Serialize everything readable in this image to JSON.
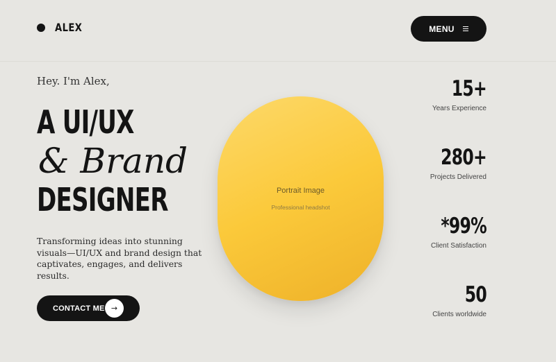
{
  "header": {
    "logo_text": "ALEX",
    "menu_label": "MENU",
    "menu_icon": "hamburger-icon"
  },
  "hero": {
    "greeting": "Hey. I'm Alex,",
    "headline_line1": "A UI/UX",
    "headline_line2": "& Brand",
    "headline_line3": "DESIGNER",
    "intro": "Transforming ideas into stunning visuals—UI/UX and brand design that captivates, engages, and delivers results.",
    "contact_label": "CONTACT ME",
    "contact_icon": "arrow-right-icon",
    "contact_arrow_glyph": "→"
  },
  "portrait": {
    "title": "Portrait Image",
    "subtitle": "Professional headshot",
    "colors": [
      "#fdd96a",
      "#fbc93a",
      "#eeb129"
    ]
  },
  "stats": [
    {
      "value": "15+",
      "label": "Years Experience"
    },
    {
      "value": "280+",
      "label": "Projects Delivered"
    },
    {
      "value": "*99%",
      "label": "Client Satisfaction"
    },
    {
      "value": "50",
      "label": "Clients worldwide"
    }
  ],
  "colors": {
    "background": "#e7e6e2",
    "primary": "#141414",
    "accent": "#fbc93a"
  }
}
